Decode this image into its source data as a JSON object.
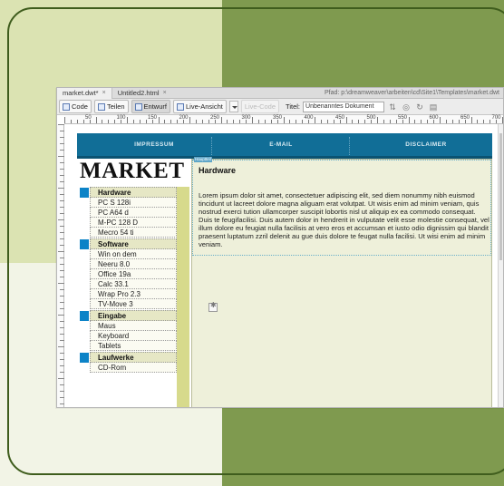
{
  "tabs": [
    {
      "label": "market.dwt*",
      "close": "×"
    },
    {
      "label": "Untitled2.html",
      "close": "×"
    }
  ],
  "path": "Pfad: p:\\dreamweaver\\arbeiten\\cd\\Site1\\Templates\\market.dwt",
  "toolbar": {
    "code": "Code",
    "split": "Teilen",
    "design": "Entwurf",
    "live_view": "Live-Ansicht",
    "live_code": "Live-Code",
    "title_label": "Titel:",
    "title_value": "Unbenanntes Dokument"
  },
  "ruler": {
    "numbers": [
      "50",
      "100",
      "150",
      "200",
      "250",
      "300",
      "350",
      "400",
      "450",
      "500",
      "550",
      "600",
      "650",
      "700"
    ]
  },
  "nav": {
    "items": [
      "IMPRESSUM",
      "E-MAIL",
      "DISCLAIMER"
    ]
  },
  "logo": "MARKET",
  "sidebar": [
    {
      "head": "Hardware",
      "items": [
        "PC S 128i",
        "PC A64 d",
        "M-PC 128 D",
        "Mecro 54 ti"
      ]
    },
    {
      "head": "Software",
      "items": [
        "Win on dem",
        "Neeru 8.0",
        "Office 19a",
        "Calc 33.1",
        "Wrap Pro 2.3",
        "TV-Move 3"
      ]
    },
    {
      "head": "Eingabe",
      "items": [
        "Maus",
        "Keyboard",
        "Tablets"
      ]
    },
    {
      "head": "Laufwerke",
      "items": [
        "CD-Rom"
      ]
    }
  ],
  "content": {
    "tag": "Hauptteil",
    "heading": "Hardware",
    "paragraph": "Lorem ipsum dolor sit amet, consectetuer adipiscing elit, sed diem nonummy nibh euismod tincidunt ut lacreet dolore magna aliguam erat volutpat. Ut wisis enim ad minim veniam, quis nostrud exerci tution ullamcorper suscipit lobortis nisl ut aliquip ex ea commodo consequat. Duis te feugifacilisi. Duis autem dolor in hendrerit in vulputate velit esse molestie consequat, vel illum dolore eu feugiat nulla facilisis at vero eros et accumsan et iusto odio dignissim qui blandit praesent luptatum zzril delenit au gue duis dolore te feugat nulla facilisi. Ut wisi enim ad minim veniam."
  },
  "colors": {
    "nav": "#116e97",
    "accent": "#0c83c7",
    "background_dark": "#7f9a4f",
    "background_light": "#dbe3b2"
  }
}
